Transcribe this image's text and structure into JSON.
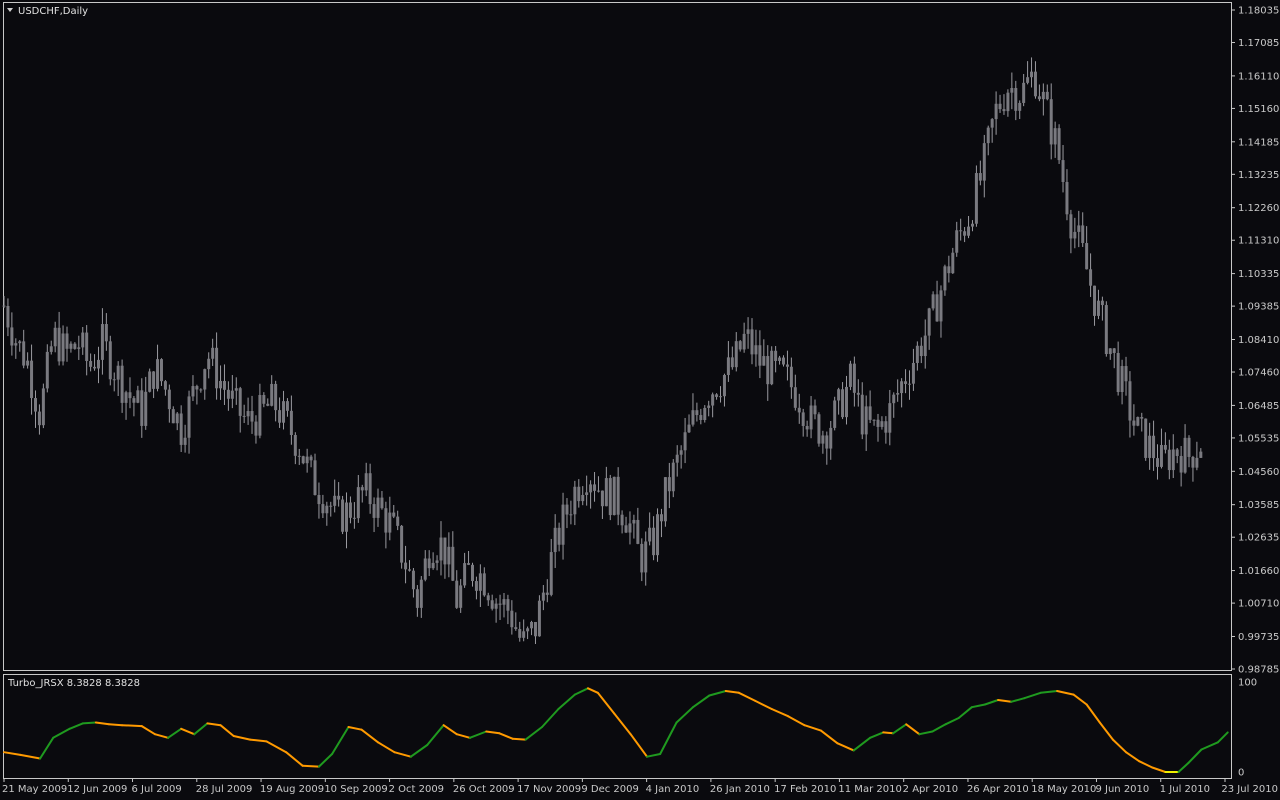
{
  "window": {
    "title": "USDCHF,Daily",
    "indicator_title": "Turbo_JRSX 8.3828 8.3828"
  },
  "colors": {
    "background": "#0a0a0e",
    "frame": "#c8c8c8",
    "candle": "#7a7a80",
    "candle_wick": "#9a9aa0",
    "indicator_up": "#1f9a1f",
    "indicator_down": "#ff9a00",
    "indicator_flat": "#f0f000",
    "text": "#c9c9c9"
  },
  "chart_data": [
    {
      "type": "candlestick",
      "title": "USDCHF,Daily",
      "price_ticks": [
        "1.18035",
        "1.17085",
        "1.16110",
        "1.15160",
        "1.14185",
        "1.13235",
        "1.12260",
        "1.11310",
        "1.10335",
        "1.09385",
        "1.08410",
        "1.07460",
        "1.06485",
        "1.05535",
        "1.04560",
        "1.03585",
        "1.02635",
        "1.01660",
        "1.00710",
        "0.99735",
        "0.98785"
      ],
      "ylim": [
        0.98785,
        1.18035
      ],
      "date_ticks": [
        "21 May 2009",
        "12 Jun 2009",
        "6 Jul 2009",
        "28 Jul 2009",
        "19 Aug 2009",
        "10 Sep 2009",
        "2 Oct 2009",
        "26 Oct 2009",
        "17 Nov 2009",
        "9 Dec 2009",
        "4 Jan 2010",
        "26 Jan 2010",
        "17 Feb 2010",
        "11 Mar 2010",
        "2 Apr 2010",
        "26 Apr 2010",
        "18 May 2010",
        "9 Jun 2010",
        "1 Jul 2010",
        "23 Jul 2010"
      ],
      "close_path": [
        [
          0,
          1.094
        ],
        [
          8,
          1.083
        ],
        [
          14,
          1.078
        ],
        [
          22,
          1.062
        ],
        [
          30,
          1.085
        ],
        [
          38,
          1.08
        ],
        [
          46,
          1.083
        ],
        [
          52,
          1.076
        ],
        [
          60,
          1.083
        ],
        [
          68,
          1.075
        ],
        [
          76,
          1.068
        ],
        [
          84,
          1.063
        ],
        [
          92,
          1.076
        ],
        [
          100,
          1.068
        ],
        [
          108,
          1.058
        ],
        [
          116,
          1.069
        ],
        [
          124,
          1.08
        ],
        [
          132,
          1.072
        ],
        [
          140,
          1.065
        ],
        [
          148,
          1.06
        ],
        [
          156,
          1.062
        ],
        [
          164,
          1.066
        ],
        [
          172,
          1.06
        ],
        [
          180,
          1.053
        ],
        [
          188,
          1.043
        ],
        [
          196,
          1.038
        ],
        [
          204,
          1.032
        ],
        [
          212,
          1.035
        ],
        [
          220,
          1.04
        ],
        [
          228,
          1.035
        ],
        [
          236,
          1.03
        ],
        [
          244,
          1.02
        ],
        [
          252,
          1.008
        ],
        [
          260,
          1.025
        ],
        [
          268,
          1.024
        ],
        [
          276,
          1.008
        ],
        [
          284,
          1.017
        ],
        [
          292,
          1.015
        ],
        [
          300,
          1.008
        ],
        [
          308,
          1.005
        ],
        [
          316,
          0.995
        ],
        [
          324,
          1.0
        ],
        [
          332,
          1.017
        ],
        [
          340,
          1.03
        ],
        [
          348,
          1.04
        ],
        [
          356,
          1.046
        ],
        [
          364,
          1.04
        ],
        [
          372,
          1.038
        ],
        [
          380,
          1.032
        ],
        [
          388,
          1.02
        ],
        [
          396,
          1.025
        ],
        [
          404,
          1.04
        ],
        [
          412,
          1.05
        ],
        [
          420,
          1.06
        ],
        [
          428,
          1.068
        ],
        [
          436,
          1.072
        ],
        [
          444,
          1.076
        ],
        [
          452,
          1.085
        ],
        [
          460,
          1.078
        ],
        [
          468,
          1.075
        ],
        [
          476,
          1.073
        ],
        [
          484,
          1.068
        ],
        [
          492,
          1.06
        ],
        [
          500,
          1.057
        ],
        [
          508,
          1.063
        ],
        [
          516,
          1.072
        ],
        [
          524,
          1.06
        ],
        [
          532,
          1.057
        ],
        [
          540,
          1.063
        ],
        [
          548,
          1.072
        ],
        [
          556,
          1.08
        ],
        [
          564,
          1.088
        ],
        [
          572,
          1.1
        ],
        [
          580,
          1.112
        ],
        [
          588,
          1.12
        ],
        [
          596,
          1.132
        ],
        [
          604,
          1.15
        ],
        [
          612,
          1.158
        ],
        [
          620,
          1.156
        ],
        [
          628,
          1.162
        ],
        [
          634,
          1.153
        ],
        [
          642,
          1.14
        ],
        [
          650,
          1.12
        ],
        [
          658,
          1.108
        ],
        [
          666,
          1.094
        ],
        [
          674,
          1.082
        ],
        [
          682,
          1.07
        ],
        [
          690,
          1.058
        ],
        [
          698,
          1.053
        ],
        [
          706,
          1.048
        ],
        [
          714,
          1.052
        ],
        [
          722,
          1.05
        ],
        [
          730,
          1.054
        ]
      ],
      "close_path_x_units": "trading days from 21 May 2009"
    },
    {
      "type": "line",
      "title": "Turbo_JRSX 8.3828 8.3828",
      "ylim": [
        0,
        100
      ],
      "y_ticks": [
        "100",
        "0"
      ],
      "x_units": "trading days from 21 May 2009",
      "points": [
        [
          0,
          22
        ],
        [
          10,
          19
        ],
        [
          22,
          15
        ],
        [
          30,
          38
        ],
        [
          40,
          48
        ],
        [
          48,
          54
        ],
        [
          56,
          55
        ],
        [
          64,
          53
        ],
        [
          72,
          52
        ],
        [
          84,
          51
        ],
        [
          92,
          42
        ],
        [
          100,
          38
        ],
        [
          108,
          48
        ],
        [
          116,
          42
        ],
        [
          124,
          54
        ],
        [
          132,
          52
        ],
        [
          140,
          40
        ],
        [
          150,
          36
        ],
        [
          160,
          34
        ],
        [
          172,
          22
        ],
        [
          182,
          7
        ],
        [
          192,
          6
        ],
        [
          200,
          20
        ],
        [
          210,
          50
        ],
        [
          218,
          47
        ],
        [
          228,
          33
        ],
        [
          238,
          22
        ],
        [
          248,
          17
        ],
        [
          258,
          30
        ],
        [
          268,
          52
        ],
        [
          276,
          42
        ],
        [
          284,
          38
        ],
        [
          294,
          45
        ],
        [
          302,
          43
        ],
        [
          310,
          37
        ],
        [
          318,
          36
        ],
        [
          328,
          50
        ],
        [
          338,
          70
        ],
        [
          348,
          86
        ],
        [
          356,
          93
        ],
        [
          362,
          88
        ],
        [
          372,
          65
        ],
        [
          382,
          42
        ],
        [
          392,
          17
        ],
        [
          400,
          20
        ],
        [
          410,
          55
        ],
        [
          420,
          72
        ],
        [
          430,
          85
        ],
        [
          440,
          90
        ],
        [
          448,
          88
        ],
        [
          458,
          79
        ],
        [
          468,
          70
        ],
        [
          478,
          62
        ],
        [
          488,
          52
        ],
        [
          498,
          46
        ],
        [
          508,
          32
        ],
        [
          518,
          24
        ],
        [
          528,
          38
        ],
        [
          536,
          44
        ],
        [
          542,
          43
        ],
        [
          550,
          53
        ],
        [
          558,
          42
        ],
        [
          566,
          45
        ],
        [
          574,
          53
        ],
        [
          582,
          60
        ],
        [
          590,
          72
        ],
        [
          598,
          75
        ],
        [
          606,
          80
        ],
        [
          614,
          78
        ],
        [
          622,
          82
        ],
        [
          632,
          88
        ],
        [
          642,
          90
        ],
        [
          652,
          86
        ],
        [
          660,
          75
        ],
        [
          668,
          55
        ],
        [
          676,
          36
        ],
        [
          684,
          22
        ],
        [
          692,
          12
        ],
        [
          700,
          5
        ],
        [
          708,
          0
        ],
        [
          716,
          0
        ],
        [
          722,
          10
        ],
        [
          730,
          25
        ],
        [
          740,
          33
        ],
        [
          746,
          44
        ]
      ]
    }
  ]
}
